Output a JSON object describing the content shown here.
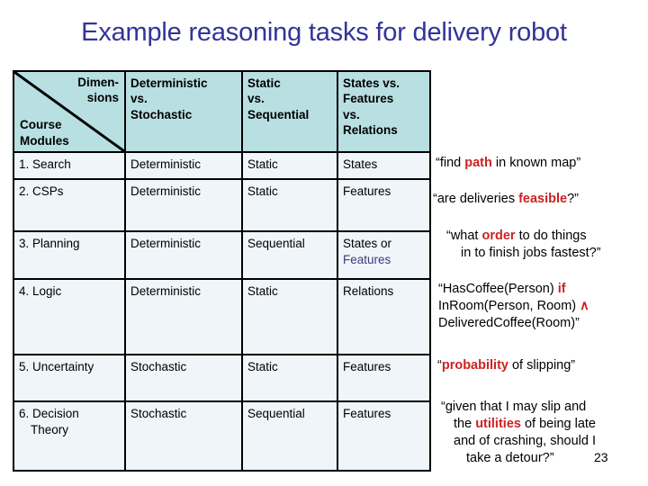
{
  "slide": {
    "title": "Example reasoning tasks for delivery robot",
    "page_number": "23",
    "title_color": "#333399",
    "highlight_color": "#cc2222",
    "cell_accent_color": "#3b3b7a",
    "header_bg": "#b8dfe2",
    "body_bg": "#eff5f9"
  },
  "table": {
    "corner": {
      "dimensions_label_line1": "Dimen-",
      "dimensions_label_line2": "sions",
      "modules_label_line1": "Course",
      "modules_label_line2": "Modules"
    },
    "headers": [
      {
        "line1": "Deterministic",
        "line2": "vs.",
        "line3": "Stochastic",
        "line4": ""
      },
      {
        "line1": "Static",
        "line2": "vs.",
        "line3": "Sequential",
        "line4": ""
      },
      {
        "line1": "States vs.",
        "line2": "Features",
        "line3": "vs.",
        "line4": "Relations"
      }
    ],
    "rows": [
      {
        "module": "1. Search",
        "module_cont": "",
        "determinism": "Deterministic",
        "determinism_accent": false,
        "time": "Static",
        "time_accent": false,
        "representation": "States",
        "representation_accent": false,
        "representation_cont": "",
        "representation_cont_accent": false
      },
      {
        "module": "2. CSPs",
        "module_cont": "",
        "determinism": "Deterministic",
        "determinism_accent": false,
        "time": "Static",
        "time_accent": false,
        "representation": "Features",
        "representation_accent": true,
        "representation_cont": "",
        "representation_cont_accent": false
      },
      {
        "module": "3. Planning",
        "module_cont": "",
        "determinism": "Deterministic",
        "determinism_accent": false,
        "time": "Sequential",
        "time_accent": true,
        "representation": "States or",
        "representation_accent": false,
        "representation_cont": "Features",
        "representation_cont_accent": true
      },
      {
        "module": "4. Logic",
        "module_cont": "",
        "determinism": "Deterministic",
        "determinism_accent": false,
        "time": "Static",
        "time_accent": false,
        "representation": "Relations",
        "representation_accent": true,
        "representation_cont": "",
        "representation_cont_accent": false
      },
      {
        "module": "5. Uncertainty",
        "module_cont": "",
        "determinism": "Stochastic",
        "determinism_accent": true,
        "time": "Static",
        "time_accent": false,
        "representation": "Features",
        "representation_accent": true,
        "representation_cont": "",
        "representation_cont_accent": false
      },
      {
        "module": "6. Decision",
        "module_cont": "Theory",
        "determinism": "Stochastic",
        "determinism_accent": true,
        "time": "Sequential",
        "time_accent": true,
        "representation": "Features",
        "representation_accent": true,
        "representation_cont": "",
        "representation_cont_accent": false
      }
    ]
  },
  "annotations": {
    "search": {
      "pre": "“find ",
      "highlight": "path",
      "post": " in known map”"
    },
    "csps": {
      "pre": "“are deliveries ",
      "highlight": "feasible",
      "post": "?”"
    },
    "planning": {
      "line1_pre": "“what ",
      "line1_highlight": "order",
      "line1_post": " to do things",
      "line2": "in to finish jobs fastest?”"
    },
    "logic": {
      "line1_pre": "“HasCoffee(Person) ",
      "line1_highlight": "if",
      "line2_pre": "InRoom(Person, Room) ",
      "line2_highlight": "∧",
      "line3": "DeliveredCoffee(Room)”"
    },
    "uncertainty": {
      "pre": "“",
      "highlight": "probability",
      "post": " of slipping”"
    },
    "decision": {
      "line1": "“given that I may slip and",
      "line2_pre": "the ",
      "line2_highlight": "utilities",
      "line2_post": " of being late",
      "line3": "and of crashing, should I",
      "line4": "take a detour?”"
    }
  }
}
